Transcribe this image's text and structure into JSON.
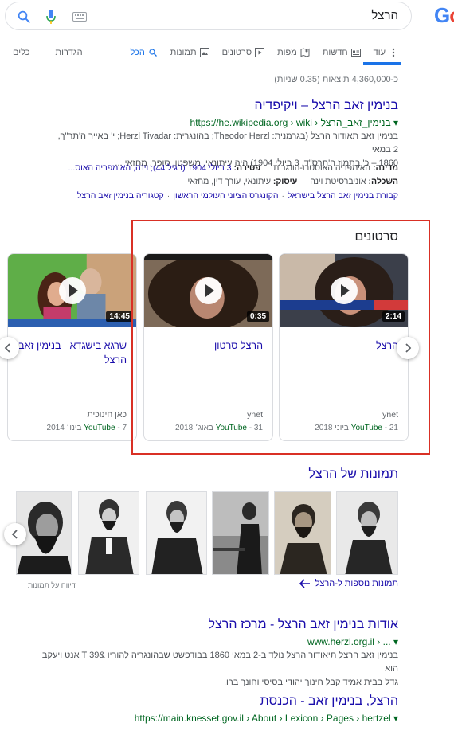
{
  "logo_text": "Go",
  "search": {
    "query": "הרצל"
  },
  "tabs": [
    {
      "label": "הכל",
      "icon": "search-icon"
    },
    {
      "label": "תמונות",
      "icon": "image-icon"
    },
    {
      "label": "סרטונים",
      "icon": "video-icon"
    },
    {
      "label": "מפות",
      "icon": "map-icon"
    },
    {
      "label": "חדשות",
      "icon": "news-icon"
    },
    {
      "label": "עוד",
      "icon": "more-vert-icon"
    }
  ],
  "tools": {
    "settings": "הגדרות",
    "tools": "כלים"
  },
  "stats": "כ-4,360,000 תוצאות (0.35 שניות)",
  "wiki": {
    "title": "בנימין זאב הרצל – ויקיפדיה",
    "url": "https://he.wikipedia.org › wiki › בנימין_זאב_הרצל ▾",
    "snippet_1": "בנימין זאב תאודור הרצל (בגרמנית: Theodor Herzl; בהונגרית: Herzl Tivadar; י' באייר ה'תר\"ך, 2 במאי",
    "snippet_2": "1860 – כ' בתמוז ה'תרס\"ד, 3 ביולי 1904) היה עיתונאי, משפטן, סופר, מחזאי ...",
    "facts": {
      "k1": "מדינה:",
      "v1": "האימפריה האוסטרו-הונגרית",
      "k2": "פטירה:",
      "v2": "3 ביולי 1904 (בגיל 44); וינה, האימפריה האוס...",
      "k3": "השכלה:",
      "v3": "אוניברסיטת וינה",
      "k4": "עיסוק:",
      "v4": "עיתונאי, עורך דין, מחזאי"
    },
    "sitelinks": [
      "קבורת בנימין זאב הרצל בישראל",
      "הקונגרס הציוני העולמי הראשון",
      "קטגוריה:בנימין זאב הרצל"
    ]
  },
  "videos": {
    "heading": "סרטונים",
    "items": [
      {
        "title": "הרצל",
        "duration": "2:14",
        "source": "ynet",
        "platform": "YouTube",
        "date": "21 ביוני 2018"
      },
      {
        "title": "הרצל סרטון",
        "duration": "0:35",
        "source": "ynet",
        "platform": "YouTube",
        "date": "31 באוג׳ 2018"
      },
      {
        "title": "שרגא בישגדא - בנימין זאב הרצל",
        "duration": "14:45",
        "source": "כאן חינוכית",
        "platform": "YouTube",
        "date": "7 בינו׳ 2014"
      }
    ]
  },
  "images": {
    "heading": "תמונות של הרצל",
    "more": "תמונות נוספות ל-הרצל",
    "report": "דיווח על תמונות"
  },
  "herzl": {
    "title": "אודות בנימין זאב הרצל - מרכז הרצל",
    "url": "www.herzl.org.il › ... ▾",
    "snippet_1": "בנימין זאב הרצל תיאודור הרצל נולד ב-2 במאי 1860 בבודפשט שבהונגריה להוריו &T 39 אנט ויעקב הוא",
    "snippet_2": "גדל בבית אמיד קבל חינוך יהודי בסיסי וחונך ברו."
  },
  "knesset": {
    "title": "הרצל, בנימין זאב - הכנסת",
    "url": "https://main.knesset.gov.il › About › Lexicon › Pages › hertzel ▾"
  },
  "colors": {
    "link": "#1a0dab",
    "url_green": "#006621",
    "accent": "#1a73e8",
    "highlight": "#d93025"
  }
}
